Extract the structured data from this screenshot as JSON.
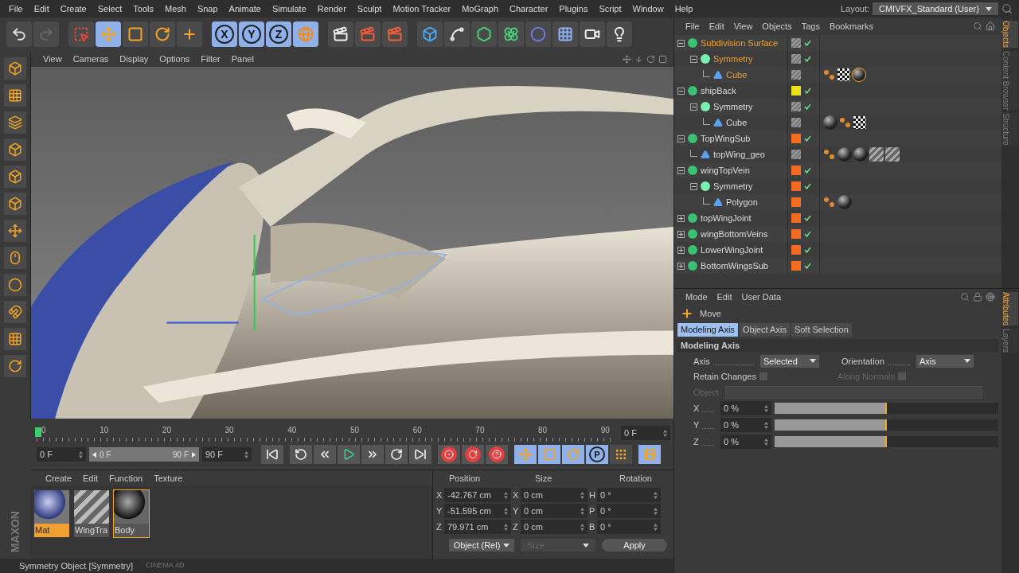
{
  "menu": [
    "File",
    "Edit",
    "Create",
    "Select",
    "Tools",
    "Mesh",
    "Snap",
    "Animate",
    "Simulate",
    "Render",
    "Sculpt",
    "Motion Tracker",
    "MoGraph",
    "Character",
    "Plugins",
    "Script",
    "Window",
    "Help"
  ],
  "layout": {
    "label": "Layout:",
    "value": "CMIVFX_Standard (User)"
  },
  "toolbar": [
    {
      "kind": "undo",
      "selected": false
    },
    {
      "kind": "redo",
      "selected": false
    },
    {
      "kind": "select",
      "selected": false
    },
    {
      "kind": "move",
      "selected": true
    },
    {
      "kind": "scale",
      "selected": false
    },
    {
      "kind": "rotate",
      "selected": false
    },
    {
      "kind": "add",
      "selected": false
    },
    {
      "kind": "axis",
      "label": "X",
      "selected": true
    },
    {
      "kind": "axis",
      "label": "Y",
      "selected": true
    },
    {
      "kind": "axis",
      "label": "Z",
      "selected": true
    },
    {
      "kind": "world",
      "selected": true
    },
    {
      "kind": "render",
      "selected": false
    },
    {
      "kind": "render-view",
      "selected": false
    },
    {
      "kind": "render-settings",
      "selected": false
    },
    {
      "kind": "cube",
      "selected": false
    },
    {
      "kind": "spline",
      "selected": false
    },
    {
      "kind": "nurbs",
      "selected": false
    },
    {
      "kind": "array",
      "selected": false
    },
    {
      "kind": "deformer",
      "selected": false
    },
    {
      "kind": "floor",
      "selected": false
    },
    {
      "kind": "camera",
      "selected": false
    },
    {
      "kind": "light",
      "selected": false
    }
  ],
  "viewport": {
    "menu": [
      "View",
      "Cameras",
      "Display",
      "Options",
      "Filter",
      "Panel"
    ]
  },
  "timeline": {
    "ticks": [
      "0",
      "10",
      "20",
      "30",
      "40",
      "50",
      "60",
      "70",
      "80",
      "90"
    ],
    "level": 0,
    "range": {
      "start": "0 F",
      "end": "90 F",
      "level": 1
    },
    "current": "0 F",
    "start": "0 F",
    "end": "90 F"
  },
  "transport": [
    {
      "kind": "first"
    },
    {
      "kind": "prev-key"
    },
    {
      "kind": "prev-frame"
    },
    {
      "kind": "play"
    },
    {
      "kind": "next-frame"
    },
    {
      "kind": "next-key"
    },
    {
      "kind": "last"
    },
    {
      "kind": "record"
    },
    {
      "kind": "autokey"
    },
    {
      "kind": "help"
    },
    {
      "kind": "key-move",
      "selected": true
    },
    {
      "kind": "key-scale",
      "selected": true
    },
    {
      "kind": "key-rotate",
      "selected": true
    },
    {
      "kind": "key-param",
      "label": "P",
      "selected": true
    },
    {
      "kind": "key-points",
      "selected": false
    },
    {
      "kind": "timeline",
      "selected": true
    }
  ],
  "materials": {
    "menu": [
      "Create",
      "Edit",
      "Function",
      "Texture"
    ],
    "items": [
      {
        "name": "Mat",
        "kind": "chrome",
        "selected": true,
        "active": false
      },
      {
        "name": "WingTra",
        "kind": "stripes",
        "selected": false,
        "active": false
      },
      {
        "name": "Body",
        "kind": "dark",
        "selected": false,
        "active": true
      }
    ]
  },
  "coordinates": {
    "headers": [
      "Position",
      "Size",
      "Rotation"
    ],
    "rows": [
      {
        "pos_label": "X",
        "pos": "-42.767 cm",
        "size_label": "X",
        "size": "0 cm",
        "rot_label": "H",
        "rot": "0 °"
      },
      {
        "pos_label": "Y",
        "pos": "-51.595 cm",
        "size_label": "Y",
        "size": "0 cm",
        "rot_label": "P",
        "rot": "0 °"
      },
      {
        "pos_label": "Z",
        "pos": "79.971 cm",
        "size_label": "Z",
        "size": "0 cm",
        "rot_label": "B",
        "rot": "0 °"
      }
    ],
    "mode": "Object (Rel)",
    "size_mode": "Size",
    "apply": "Apply"
  },
  "logo": [
    "MAXON",
    "CINEMA 4D"
  ],
  "status_bar": "Symmetry Object [Symmetry]",
  "objects": {
    "menu": [
      "File",
      "Edit",
      "View",
      "Objects",
      "Tags",
      "Bookmarks"
    ],
    "tree": [
      {
        "name": "Subdivision Surface",
        "kind": "generator",
        "selected": true,
        "checked": true,
        "expanded": true,
        "children": [
          {
            "name": "Symmetry",
            "kind": "symmetry",
            "selected": true,
            "checked": true,
            "expanded": true,
            "children": [
              {
                "name": "Cube",
                "kind": "polygon",
                "selected": true,
                "tags": [
                  {
                    "kind": "phong",
                    "selected": false
                  },
                  {
                    "kind": "texture",
                    "selected": false
                  },
                  {
                    "kind": "material",
                    "selected": true
                  }
                ]
              }
            ]
          }
        ]
      },
      {
        "name": "shipBack",
        "kind": "generator",
        "selected": false,
        "checked": true,
        "expanded": true,
        "color": "#ece21c",
        "children": [
          {
            "name": "Symmetry",
            "kind": "symmetry",
            "selected": false,
            "checked": true,
            "expanded": true,
            "children": [
              {
                "name": "Cube",
                "kind": "polygon",
                "selected": false,
                "tags": [
                  {
                    "kind": "material",
                    "selected": false
                  },
                  {
                    "kind": "phong",
                    "selected": false
                  },
                  {
                    "kind": "texture",
                    "selected": false
                  }
                ]
              }
            ]
          }
        ]
      },
      {
        "name": "TopWingSub",
        "kind": "generator",
        "selected": false,
        "checked": true,
        "expanded": true,
        "color": "#f26b21",
        "children": [
          {
            "name": "topWing_geo",
            "kind": "polygon",
            "selected": false,
            "tags": [
              {
                "kind": "phong",
                "selected": false
              },
              {
                "kind": "material",
                "selected": false
              },
              {
                "kind": "material",
                "selected": false
              },
              {
                "kind": "stripes",
                "selected": false
              },
              {
                "kind": "stripes",
                "selected": false
              }
            ]
          }
        ]
      },
      {
        "name": "wingTopVein",
        "kind": "generator",
        "selected": false,
        "checked": true,
        "expanded": true,
        "color": "#f26b21",
        "children": [
          {
            "name": "Symmetry",
            "kind": "symmetry",
            "selected": false,
            "checked": true,
            "expanded": true,
            "color": "#f26b21",
            "children": [
              {
                "name": "Polygon",
                "kind": "polygon",
                "selected": false,
                "color": "#f26b21",
                "tags": [
                  {
                    "kind": "phong",
                    "selected": false
                  },
                  {
                    "kind": "material",
                    "selected": false
                  }
                ]
              }
            ]
          }
        ]
      },
      {
        "name": "topWingJoint",
        "kind": "generator",
        "selected": false,
        "checked": true,
        "expanded": false,
        "color": "#f26b21"
      },
      {
        "name": "wingBottomVeins",
        "kind": "generator",
        "selected": false,
        "checked": true,
        "expanded": false,
        "color": "#f26b21"
      },
      {
        "name": "LowerWingJoint",
        "kind": "generator",
        "selected": false,
        "checked": true,
        "expanded": false,
        "color": "#f26b21"
      },
      {
        "name": "BottomWingsSub",
        "kind": "generator",
        "selected": false,
        "checked": true,
        "expanded": false,
        "color": "#f26b21"
      }
    ]
  },
  "object_tabs": [
    {
      "label": "Objects",
      "selected": true
    },
    {
      "label": "Content Browser",
      "selected": false
    },
    {
      "label": "Structure",
      "selected": false
    }
  ],
  "attributes": {
    "menu": [
      "Mode",
      "Edit",
      "User Data"
    ],
    "tool": "Move",
    "tabs": [
      {
        "label": "Modeling Axis",
        "selected": true
      },
      {
        "label": "Object Axis",
        "selected": false
      },
      {
        "label": "Soft Selection",
        "selected": false
      }
    ],
    "section": "Modeling Axis",
    "axis": {
      "label": "Axis",
      "value": "Selected"
    },
    "orientation": {
      "label": "Orientation",
      "value": "Axis"
    },
    "checks": [
      {
        "label": "Retain Changes",
        "checked": false,
        "disabled": false
      },
      {
        "label": "Along Normals",
        "checked": false,
        "disabled": true
      }
    ],
    "object": {
      "label": "Object",
      "disabled": true
    },
    "sliders": [
      {
        "label": "X",
        "value": "0 %",
        "level": 0.5
      },
      {
        "label": "Y",
        "value": "0 %",
        "level": 0.5
      },
      {
        "label": "Z",
        "value": "0 %",
        "level": 0.5
      }
    ]
  },
  "attribute_tabs": [
    {
      "label": "Attributes",
      "selected": true
    },
    {
      "label": "Layers",
      "selected": false
    }
  ]
}
